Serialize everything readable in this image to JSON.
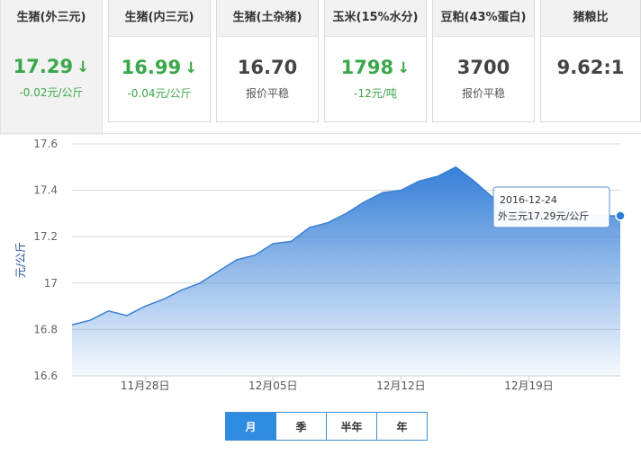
{
  "tabs": [
    {
      "title": "生猪(外三元)",
      "value": "17.29",
      "arrow": "down",
      "sub": "-0.02元/公斤"
    },
    {
      "title": "生猪(内三元)",
      "value": "16.99",
      "arrow": "down",
      "sub": "-0.04元/公斤"
    },
    {
      "title": "生猪(土杂猪)",
      "value": "16.70",
      "arrow": "",
      "sub": "报价平稳"
    },
    {
      "title": "玉米(15%水分)",
      "value": "1798",
      "arrow": "down",
      "sub": "-12元/吨"
    },
    {
      "title": "豆粕(43%蛋白)",
      "value": "3700",
      "arrow": "",
      "sub": "报价平稳"
    },
    {
      "title": "猪粮比",
      "value": "9.62:1",
      "arrow": "",
      "sub": ""
    }
  ],
  "arrow_glyph": "↓",
  "colors": {
    "accent": "#2f8ce0",
    "down": "#3aa74a",
    "line": "#3a7fd5"
  },
  "chart_data": {
    "type": "area",
    "ylabel": "元/公斤",
    "ylim": [
      16.6,
      17.6
    ],
    "yticks": [
      "16.6",
      "16.8",
      "17",
      "17.2",
      "17.4",
      "17.6"
    ],
    "xticks": [
      "11月28日",
      "12月05日",
      "12月12日",
      "12月19日"
    ],
    "grid": true,
    "series": [
      {
        "x": [
          "2016-11-24",
          "2016-11-25",
          "2016-11-26",
          "2016-11-27",
          "2016-11-28",
          "2016-11-29",
          "2016-11-30",
          "2016-12-01",
          "2016-12-02",
          "2016-12-03",
          "2016-12-04",
          "2016-12-05",
          "2016-12-06",
          "2016-12-07",
          "2016-12-08",
          "2016-12-09",
          "2016-12-10",
          "2016-12-11",
          "2016-12-12",
          "2016-12-13",
          "2016-12-14",
          "2016-12-15",
          "2016-12-16",
          "2016-12-17",
          "2016-12-18",
          "2016-12-19",
          "2016-12-20",
          "2016-12-21",
          "2016-12-22",
          "2016-12-23",
          "2016-12-24"
        ],
        "values": [
          16.82,
          16.84,
          16.88,
          16.86,
          16.9,
          16.93,
          16.97,
          17.0,
          17.05,
          17.1,
          17.12,
          17.17,
          17.18,
          17.24,
          17.26,
          17.3,
          17.35,
          17.39,
          17.4,
          17.44,
          17.46,
          17.5,
          17.44,
          17.37,
          17.33,
          17.31,
          17.31,
          17.31,
          17.3,
          17.29,
          17.29
        ]
      }
    ],
    "tooltip": {
      "date": "2016-12-24",
      "text": "外三元17.29元/公斤"
    }
  },
  "range_buttons": [
    {
      "label": "月",
      "active": true
    },
    {
      "label": "季",
      "active": false
    },
    {
      "label": "半年",
      "active": false
    },
    {
      "label": "年",
      "active": false
    }
  ]
}
